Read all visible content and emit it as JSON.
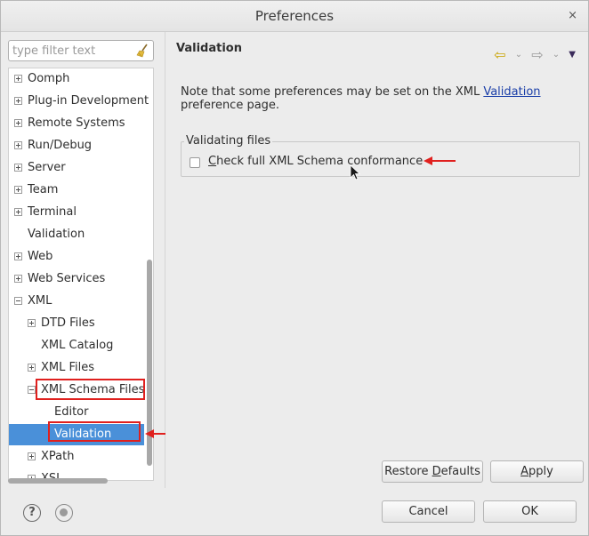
{
  "window": {
    "title": "Preferences",
    "close_glyph": "×"
  },
  "filter": {
    "placeholder": "type filter text",
    "value": ""
  },
  "tree": {
    "items": [
      {
        "label": "Oomph",
        "expander": "plus",
        "indent": 0
      },
      {
        "label": "Plug-in Development",
        "expander": "plus",
        "indent": 0
      },
      {
        "label": "Remote Systems",
        "expander": "plus",
        "indent": 0
      },
      {
        "label": "Run/Debug",
        "expander": "plus",
        "indent": 0
      },
      {
        "label": "Server",
        "expander": "plus",
        "indent": 0
      },
      {
        "label": "Team",
        "expander": "plus",
        "indent": 0
      },
      {
        "label": "Terminal",
        "expander": "plus",
        "indent": 0
      },
      {
        "label": "Validation",
        "expander": "none",
        "indent": 0
      },
      {
        "label": "Web",
        "expander": "plus",
        "indent": 0
      },
      {
        "label": "Web Services",
        "expander": "plus",
        "indent": 0
      },
      {
        "label": "XML",
        "expander": "minus",
        "indent": 0
      },
      {
        "label": "DTD Files",
        "expander": "plus",
        "indent": 1
      },
      {
        "label": "XML Catalog",
        "expander": "none",
        "indent": 1
      },
      {
        "label": "XML Files",
        "expander": "plus",
        "indent": 1
      },
      {
        "label": "XML Schema Files",
        "expander": "minus",
        "indent": 1
      },
      {
        "label": "Editor",
        "expander": "none",
        "indent": 2
      },
      {
        "label": "Validation",
        "expander": "none",
        "indent": 2,
        "selected": true
      },
      {
        "label": "XPath",
        "expander": "plus",
        "indent": 1
      },
      {
        "label": "XSL",
        "expander": "plus",
        "indent": 1
      }
    ]
  },
  "page": {
    "title": "Validation",
    "note_text": "Note that some preferences may be set on the XML ",
    "note_link": "Validation",
    "note_suffix": " preference page.",
    "group_label": "Validating files",
    "checkbox_label_mnemonic": "C",
    "checkbox_label_rest": "heck full XML Schema conformance",
    "checkbox_checked": false
  },
  "nav": {
    "back_glyph": "⇦",
    "forward_glyph": "⇨",
    "chevron_glyph": "⌄",
    "menu_glyph": "▼"
  },
  "buttons": {
    "restore_pre": "Restore ",
    "restore_mn": "D",
    "restore_post": "efaults",
    "apply_mn": "A",
    "apply_post": "pply",
    "cancel": "Cancel",
    "ok": "OK"
  },
  "icons": {
    "help": "?"
  },
  "colors": {
    "selection": "#4a90d9",
    "annotation": "#e0201e",
    "link": "#1a3ea8"
  }
}
